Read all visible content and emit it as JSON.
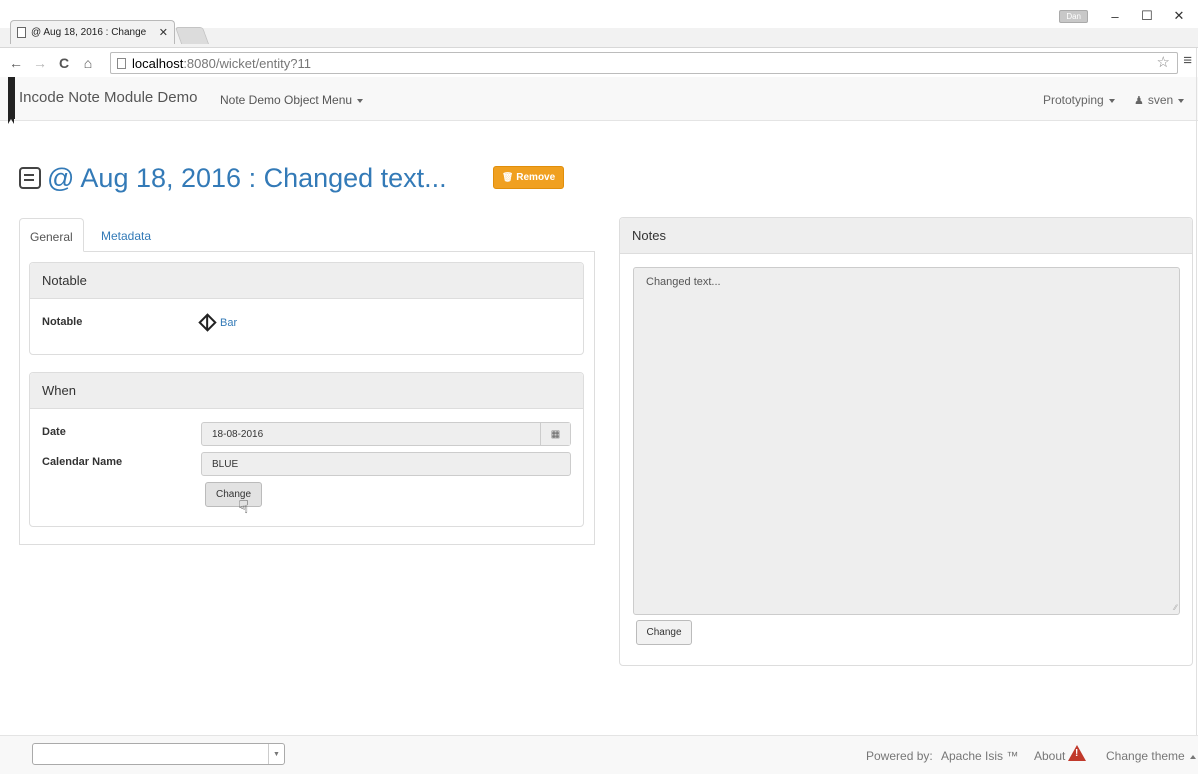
{
  "browser": {
    "tab_title": "@ Aug 18, 2016 : Change",
    "tab_close": "✕",
    "user_badge": "Dan",
    "win_minimize": "–",
    "win_maximize": "☐",
    "win_close": "✕",
    "url_host": "localhost",
    "url_rest": ":8080/wicket/entity?11",
    "back_icon": "←",
    "forward_icon": "→",
    "reload_icon": "C",
    "home_icon": "⌂",
    "star_icon": "☆",
    "menu_icon": "≡"
  },
  "navbar": {
    "brand": "Incode Note Module Demo",
    "menu": "Note Demo Object Menu",
    "prototyping": "Prototyping",
    "user": "sven"
  },
  "page": {
    "title": "@ Aug 18, 2016 : Changed text...",
    "remove_label": "Remove"
  },
  "tabs": {
    "general": "General",
    "metadata": "Metadata"
  },
  "notable_panel": {
    "heading": "Notable",
    "field_label": "Notable",
    "value": "Bar"
  },
  "when_panel": {
    "heading": "When",
    "date_label": "Date",
    "date_value": "18-08-2016",
    "calendar_label": "Calendar Name",
    "calendar_value": "BLUE",
    "change_label": "Change"
  },
  "notes_panel": {
    "heading": "Notes",
    "text": "Changed text...",
    "change_label": "Change"
  },
  "footer": {
    "powered_by": "Powered by:",
    "apache_isis": "Apache Isis ™",
    "about": "About",
    "change_theme": "Change theme"
  },
  "colors": {
    "link": "#337ab7",
    "remove_button": "#f0a020",
    "warning": "#c0392b"
  }
}
